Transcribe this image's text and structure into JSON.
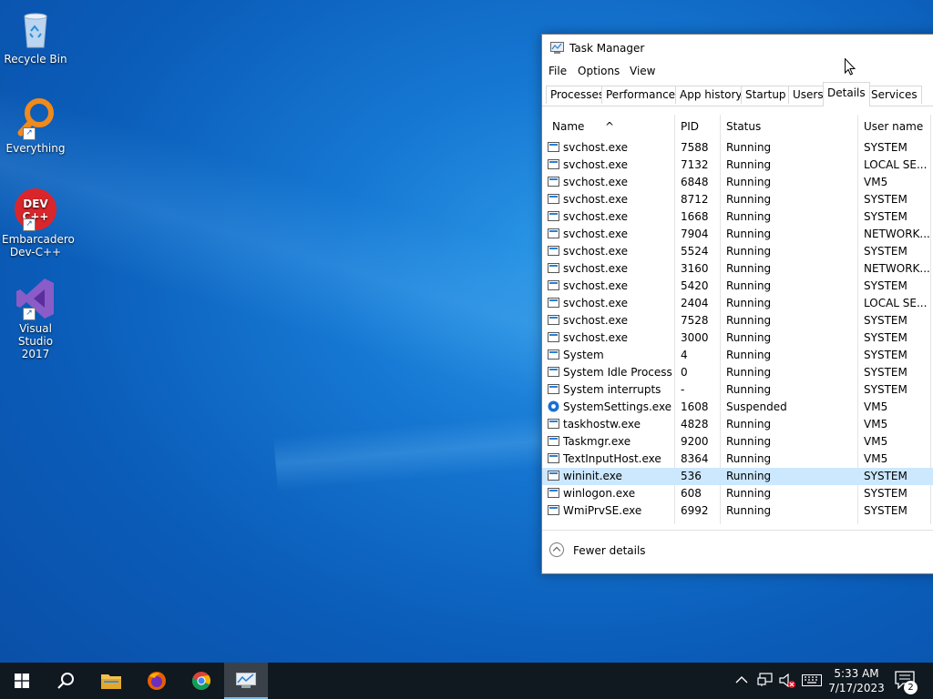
{
  "desktop": {
    "icons": [
      {
        "label": "Recycle Bin",
        "icon": "recycle-bin-icon"
      },
      {
        "label": "Everything",
        "icon": "everything-search-icon"
      },
      {
        "label": "Embarcadero\nDev-C++",
        "icon": "devcpp-icon",
        "badge": "DEV\nC++"
      },
      {
        "label": "Visual Studio\n2017",
        "icon": "visual-studio-icon"
      }
    ]
  },
  "task_manager": {
    "title": "Task Manager",
    "menu": [
      "File",
      "Options",
      "View"
    ],
    "tabs": [
      "Processes",
      "Performance",
      "App history",
      "Startup",
      "Users",
      "Details",
      "Services"
    ],
    "active_tab": "Details",
    "columns": [
      "Name",
      "PID",
      "Status",
      "User name"
    ],
    "sort_indicator": "^",
    "rows": [
      {
        "name": "svchost.exe",
        "pid": "7588",
        "status": "Running",
        "user": "SYSTEM"
      },
      {
        "name": "svchost.exe",
        "pid": "7132",
        "status": "Running",
        "user": "LOCAL SE..."
      },
      {
        "name": "svchost.exe",
        "pid": "6848",
        "status": "Running",
        "user": "VM5"
      },
      {
        "name": "svchost.exe",
        "pid": "8712",
        "status": "Running",
        "user": "SYSTEM"
      },
      {
        "name": "svchost.exe",
        "pid": "1668",
        "status": "Running",
        "user": "SYSTEM"
      },
      {
        "name": "svchost.exe",
        "pid": "7904",
        "status": "Running",
        "user": "NETWORK..."
      },
      {
        "name": "svchost.exe",
        "pid": "5524",
        "status": "Running",
        "user": "SYSTEM"
      },
      {
        "name": "svchost.exe",
        "pid": "3160",
        "status": "Running",
        "user": "NETWORK..."
      },
      {
        "name": "svchost.exe",
        "pid": "5420",
        "status": "Running",
        "user": "SYSTEM"
      },
      {
        "name": "svchost.exe",
        "pid": "2404",
        "status": "Running",
        "user": "LOCAL SE..."
      },
      {
        "name": "svchost.exe",
        "pid": "7528",
        "status": "Running",
        "user": "SYSTEM"
      },
      {
        "name": "svchost.exe",
        "pid": "3000",
        "status": "Running",
        "user": "SYSTEM"
      },
      {
        "name": "System",
        "pid": "4",
        "status": "Running",
        "user": "SYSTEM"
      },
      {
        "name": "System Idle Process",
        "pid": "0",
        "status": "Running",
        "user": "SYSTEM"
      },
      {
        "name": "System interrupts",
        "pid": "-",
        "status": "Running",
        "user": "SYSTEM"
      },
      {
        "name": "SystemSettings.exe",
        "pid": "1608",
        "status": "Suspended",
        "user": "VM5",
        "icon": "gear"
      },
      {
        "name": "taskhostw.exe",
        "pid": "4828",
        "status": "Running",
        "user": "VM5"
      },
      {
        "name": "Taskmgr.exe",
        "pid": "9200",
        "status": "Running",
        "user": "VM5"
      },
      {
        "name": "TextInputHost.exe",
        "pid": "8364",
        "status": "Running",
        "user": "VM5"
      },
      {
        "name": "wininit.exe",
        "pid": "536",
        "status": "Running",
        "user": "SYSTEM",
        "selected": true
      },
      {
        "name": "winlogon.exe",
        "pid": "608",
        "status": "Running",
        "user": "SYSTEM"
      },
      {
        "name": "WmiPrvSE.exe",
        "pid": "6992",
        "status": "Running",
        "user": "SYSTEM"
      }
    ],
    "footer_label": "Fewer details"
  },
  "taskbar": {
    "pinned": [
      "start-icon",
      "search-icon",
      "file-explorer-icon",
      "firefox-icon",
      "chrome-icon",
      "task-manager-icon"
    ],
    "active": "task-manager-icon",
    "tray_icons": [
      "chevron-up-icon",
      "network-icon",
      "volume-muted-icon",
      "keyboard-icon"
    ],
    "time": "5:33 AM",
    "date": "7/17/2023",
    "notification_count": "2"
  },
  "colors": {
    "desktop_bg": "#0a5cb8",
    "taskbar_bg": "#101820",
    "selected_row": "#cce8ff",
    "accent": "#76b9ed"
  }
}
